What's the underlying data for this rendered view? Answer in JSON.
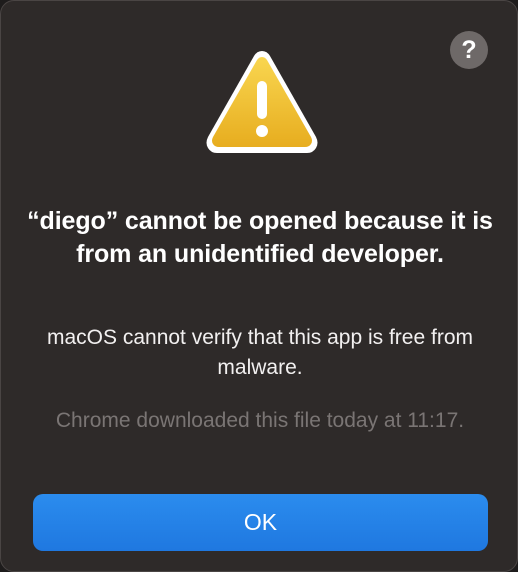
{
  "dialog": {
    "help_label": "?",
    "title": "“diego” cannot be opened because it is from an unidentified developer.",
    "message": "macOS cannot verify that this app is free from malware.",
    "note": "Chrome downloaded this file today at 11:17.",
    "ok_label": "OK",
    "icon": "warning-icon"
  },
  "colors": {
    "background": "#2e2a29",
    "accent": "#1f78e0",
    "warning": "#f2c232"
  }
}
